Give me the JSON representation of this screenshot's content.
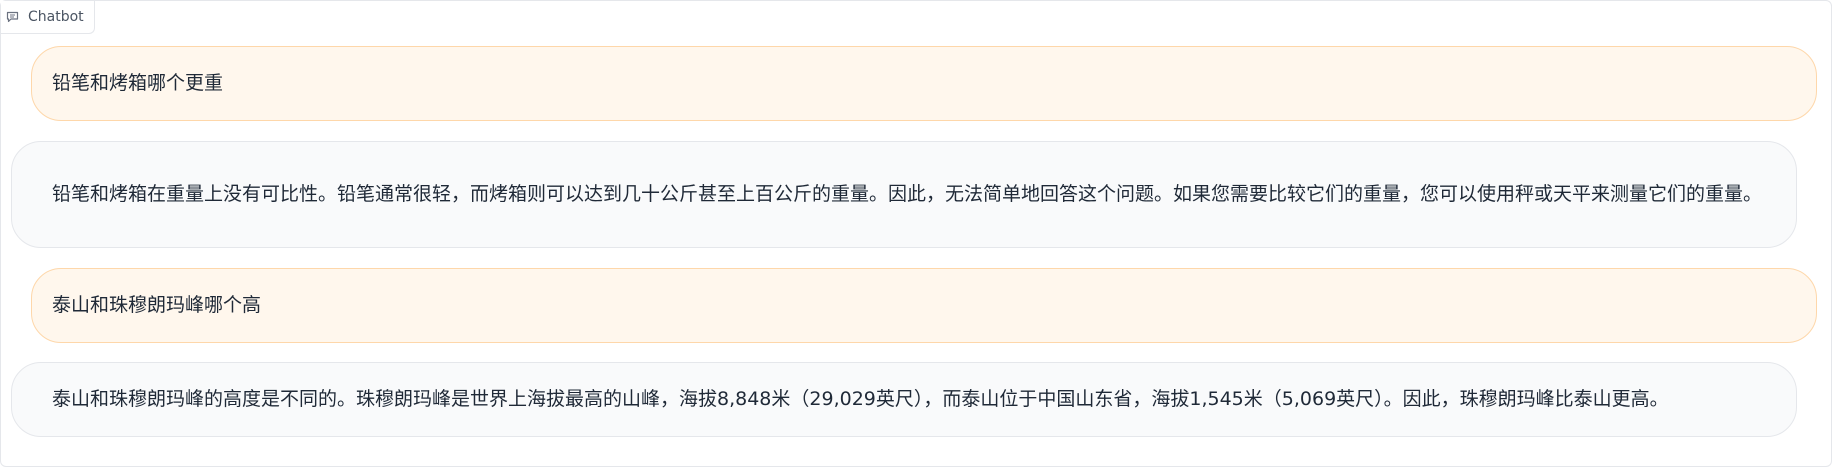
{
  "header": {
    "label": "Chatbot",
    "icon": "chat-bubble-icon"
  },
  "messages": [
    {
      "role": "user",
      "text": "铅笔和烤箱哪个更重"
    },
    {
      "role": "bot",
      "text": "铅笔和烤箱在重量上没有可比性。铅笔通常很轻，而烤箱则可以达到几十公斤甚至上百公斤的重量。因此，无法简单地回答这个问题。如果您需要比较它们的重量，您可以使用秤或天平来测量它们的重量。"
    },
    {
      "role": "user",
      "text": "泰山和珠穆朗玛峰哪个高"
    },
    {
      "role": "bot",
      "text": "泰山和珠穆朗玛峰的高度是不同的。珠穆朗玛峰是世界上海拔最高的山峰，海拔8,848米（29,029英尺），而泰山位于中国山东省，海拔1,545米（5,069英尺）。因此，珠穆朗玛峰比泰山更高。"
    }
  ],
  "colors": {
    "user_bubble_bg": "#fff7ed",
    "user_bubble_border": "#fed7aa",
    "bot_bubble_bg": "#f9fafb",
    "bot_bubble_border": "#e5e7eb"
  }
}
